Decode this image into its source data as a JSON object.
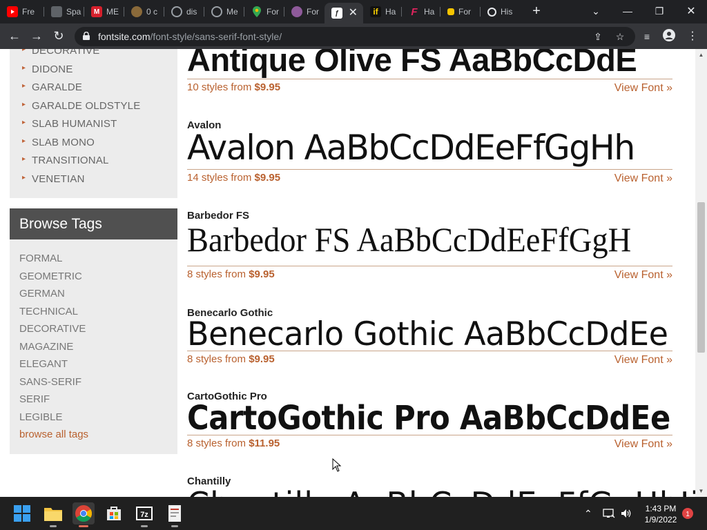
{
  "browser": {
    "tabs": [
      {
        "title": "Fre",
        "favicon": "youtube-icon",
        "color": "#ff0000"
      },
      {
        "title": "Spa",
        "favicon": "spartan-helmet-icon",
        "color": "#9aa0a6"
      },
      {
        "title": "ME",
        "favicon": "m-logo-icon",
        "color": "#d6202c"
      },
      {
        "title": "0 c",
        "favicon": "circle-badge-icon",
        "color": "#8a6a3a"
      },
      {
        "title": "dis",
        "favicon": "globe-icon",
        "color": "#9aa0a6"
      },
      {
        "title": "Me",
        "favicon": "globe-icon",
        "color": "#9aa0a6"
      },
      {
        "title": "For",
        "favicon": "maps-pin-icon",
        "color": "#34a853"
      },
      {
        "title": "For",
        "favicon": "purple-head-icon",
        "color": "#8e5a9a"
      },
      {
        "title": "",
        "favicon": "fontsite-icon",
        "color": "#ffffff",
        "active": true
      },
      {
        "title": "Ha",
        "favicon": "if-logo-icon",
        "color": "#ffd400"
      },
      {
        "title": "Ha",
        "favicon": "f-script-icon",
        "color": "#e0245e"
      },
      {
        "title": "For",
        "favicon": "yellow-square-icon",
        "color": "#f5c400"
      },
      {
        "title": "His",
        "favicon": "history-icon",
        "color": "#e8eaed"
      }
    ],
    "address": {
      "domain": "fontsite.com",
      "path": "/font-style/sans-serif-font-style/"
    }
  },
  "sidebar": {
    "categories": [
      "DECORATIVE",
      "DIDONE",
      "GARALDE",
      "GARALDE OLDSTYLE",
      "SLAB HUMANIST",
      "SLAB MONO",
      "TRANSITIONAL",
      "VENETIAN"
    ],
    "tags_heading": "Browse Tags",
    "tags": [
      "FORMAL",
      "GEOMETRIC",
      "GERMAN",
      "TECHNICAL",
      "DECORATIVE",
      "MAGAZINE",
      "ELEGANT",
      "SANS-SERIF",
      "SERIF",
      "LEGIBLE"
    ],
    "browse_all": "browse all tags"
  },
  "fonts": [
    {
      "name": "",
      "sample": "Antique Olive FS AaBbCcDdE",
      "styles_prefix": "10 styles from",
      "price": "$9.95",
      "view": "View Font »"
    },
    {
      "name": "Avalon",
      "sample": "Avalon AaBbCcDdEeFfGgHh",
      "styles_prefix": "14 styles from",
      "price": "$9.95",
      "view": "View Font »"
    },
    {
      "name": "Barbedor FS",
      "sample": "Barbedor FS AaBbCcDdEeFfGgH",
      "styles_prefix": "8 styles from",
      "price": "$9.95",
      "view": "View Font »"
    },
    {
      "name": "Benecarlo Gothic",
      "sample": "Benecarlo Gothic AaBbCcDdEe",
      "styles_prefix": "8 styles from",
      "price": "$9.95",
      "view": "View Font »"
    },
    {
      "name": "CartoGothic Pro",
      "sample": "CartoGothic Pro AaBbCcDdEe",
      "styles_prefix": "8 styles from",
      "price": "$11.95",
      "view": "View Font »"
    },
    {
      "name": "Chantilly",
      "sample": "Chantilly AaBbCcDdEeFfGgHhIi",
      "styles_prefix": "",
      "price": "",
      "view": ""
    }
  ],
  "taskbar": {
    "apps": [
      "start-icon",
      "file-explorer-icon",
      "chrome-icon",
      "store-icon",
      "7zip-icon",
      "document-app-icon"
    ],
    "time": "1:43 PM",
    "date": "1/9/2022",
    "notification_count": "1"
  },
  "colors": {
    "accent": "#b9612f",
    "rule": "#c9a489",
    "sidebar_bg": "#ececec",
    "tags_header_bg": "#505050"
  }
}
